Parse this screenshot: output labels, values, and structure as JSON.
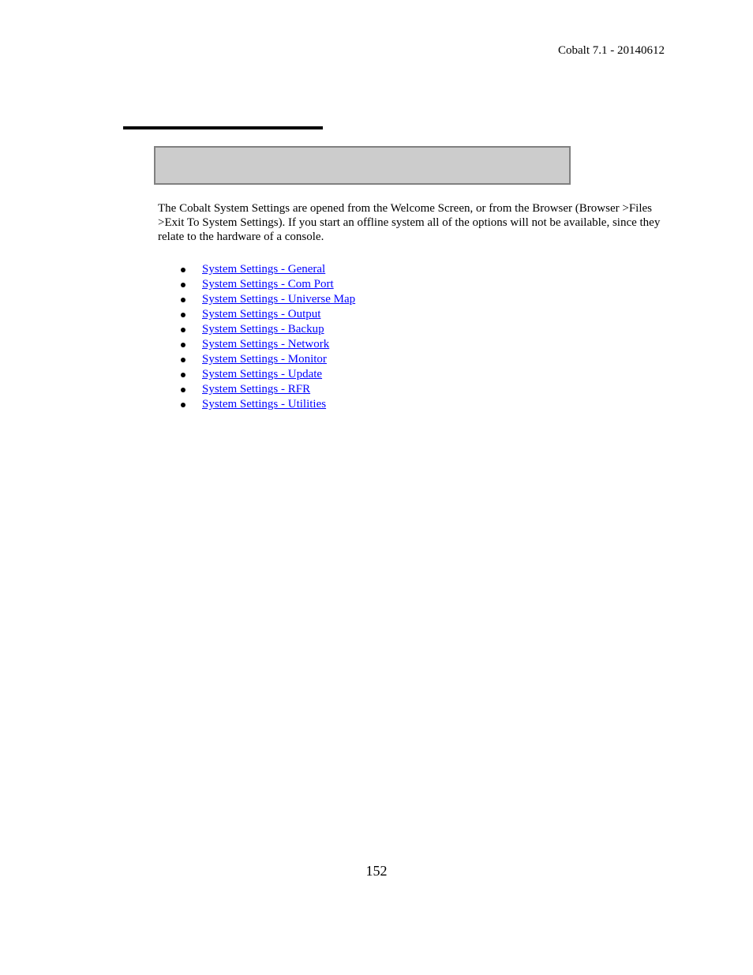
{
  "header": {
    "text": "Cobalt 7.1 - 20140612"
  },
  "heading_box": {
    "text": ""
  },
  "intro": {
    "text": "The Cobalt System Settings are opened from the Welcome Screen, or from the Browser (Browser >Files >Exit To System Settings). If you start an offline system all of the options will not be available, since they relate to the hardware of a console."
  },
  "links": [
    {
      "label": "System Settings - General"
    },
    {
      "label": "System Settings - Com Port"
    },
    {
      "label": "System Settings - Universe Map"
    },
    {
      "label": "System Settings - Output"
    },
    {
      "label": "System Settings - Backup"
    },
    {
      "label": "System Settings - Network"
    },
    {
      "label": "System Settings - Monitor"
    },
    {
      "label": "System Settings - Update"
    },
    {
      "label": "System Settings - RFR"
    },
    {
      "label": "System Settings - Utilities"
    }
  ],
  "footer": {
    "page_number": "152"
  },
  "colors": {
    "link": "#0000ff",
    "box_fill": "#cccccc",
    "box_border": "#808080"
  }
}
